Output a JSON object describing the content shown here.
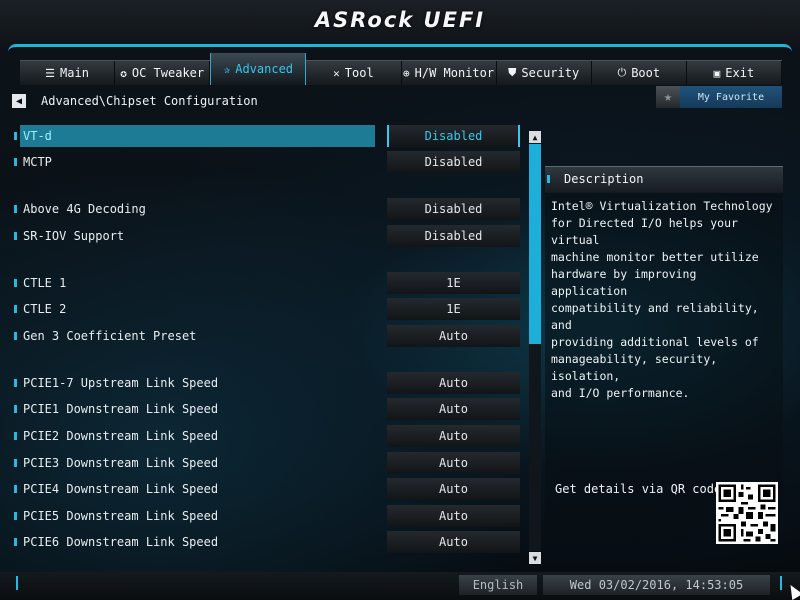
{
  "app": {
    "logo": "ASRock UEFI"
  },
  "tabs": [
    {
      "label": "Main",
      "icon": "list-icon",
      "glyph": "☰"
    },
    {
      "label": "OC Tweaker",
      "icon": "rocket-icon",
      "glyph": "✪"
    },
    {
      "label": "Advanced",
      "icon": "star-icon",
      "glyph": "✰",
      "active": true
    },
    {
      "label": "Tool",
      "icon": "tools-icon",
      "glyph": "✕"
    },
    {
      "label": "H/W Monitor",
      "icon": "globe-icon",
      "glyph": "⊕"
    },
    {
      "label": "Security",
      "icon": "shield-icon",
      "glyph": "⛊"
    },
    {
      "label": "Boot",
      "icon": "power-icon",
      "glyph": "⏻"
    },
    {
      "label": "Exit",
      "icon": "exit-icon",
      "glyph": "▣"
    }
  ],
  "breadcrumb": "Advanced\\Chipset Configuration",
  "favorite": {
    "label": "My Favorite",
    "icon": "star-icon"
  },
  "settings": [
    {
      "label": "VT-d",
      "value": "Disabled",
      "selected": true
    },
    {
      "label": "MCTP",
      "value": "Disabled"
    },
    {
      "label": "Above 4G Decoding",
      "value": "Disabled"
    },
    {
      "label": "SR-IOV Support",
      "value": "Disabled"
    },
    {
      "label": "CTLE 1",
      "value": "1E"
    },
    {
      "label": "CTLE 2",
      "value": "1E"
    },
    {
      "label": "Gen 3 Coefficient Preset",
      "value": "Auto"
    },
    {
      "label": "PCIE1-7 Upstream Link Speed",
      "value": "Auto"
    },
    {
      "label": "PCIE1 Downstream Link Speed",
      "value": "Auto"
    },
    {
      "label": "PCIE2 Downstream Link Speed",
      "value": "Auto"
    },
    {
      "label": "PCIE3 Downstream Link Speed",
      "value": "Auto"
    },
    {
      "label": "PCIE4 Downstream Link Speed",
      "value": "Auto"
    },
    {
      "label": "PCIE5 Downstream Link Speed",
      "value": "Auto"
    },
    {
      "label": "PCIE6 Downstream Link Speed",
      "value": "Auto"
    }
  ],
  "description": {
    "title": "Description",
    "text": "Intel® Virtualization Technology\nfor Directed I/O helps your virtual\nmachine monitor better utilize\nhardware by improving application\ncompatibility and reliability, and\nproviding additional levels of\nmanageability, security, isolation,\nand I/O performance.",
    "qr_label": "Get details via QR code"
  },
  "footer": {
    "language": "English",
    "datetime": "Wed 03/02/2016, 14:53:05"
  },
  "colors": {
    "accent": "#1fb5dc",
    "selected_row": "#1d7b96"
  }
}
